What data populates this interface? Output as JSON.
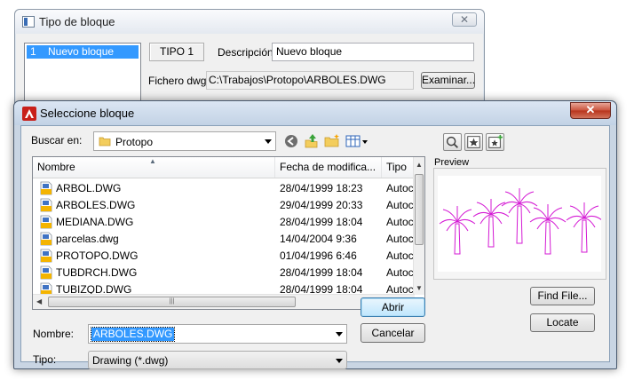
{
  "background_dialog": {
    "title": "Tipo de bloque",
    "close_label": "✕",
    "list_item_number": "1",
    "list_item_name": "Nuevo bloque",
    "tipo_label": "TIPO 1",
    "descripcion_label": "Descripción",
    "descripcion_value": "Nuevo bloque",
    "fichero_label": "Fichero dwg",
    "fichero_value": "C:\\Trabajos\\Protopo\\ARBOLES.DWG",
    "browse_label": "Examinar..."
  },
  "dialog": {
    "title": "Seleccione bloque",
    "close_label": "✕",
    "lookin_label": "Buscar en:",
    "lookin_value": "Protopo",
    "columns": [
      "Nombre",
      "Fecha de modifica...",
      "Tipo"
    ],
    "files": [
      {
        "name": "ARBOL.DWG",
        "date": "28/04/1999 18:23",
        "type": "Autoc"
      },
      {
        "name": "ARBOLES.DWG",
        "date": "29/04/1999 20:33",
        "type": "Autoc"
      },
      {
        "name": "MEDIANA.DWG",
        "date": "28/04/1999 18:04",
        "type": "Autoc"
      },
      {
        "name": "parcelas.dwg",
        "date": "14/04/2004 9:36",
        "type": "Autoc"
      },
      {
        "name": "PROTOPO.DWG",
        "date": "01/04/1996 6:46",
        "type": "Autoc"
      },
      {
        "name": "TUBDRCH.DWG",
        "date": "28/04/1999 18:04",
        "type": "Autoc"
      },
      {
        "name": "TUBIZQD.DWG",
        "date": "28/04/1999 18:04",
        "type": "Autoc"
      }
    ],
    "preview_label": "Preview",
    "find_file_label": "Find File...",
    "locate_label": "Locate",
    "nombre_label": "Nombre:",
    "nombre_value": "ARBOLES.DWG",
    "tipo_label": "Tipo:",
    "tipo_value": "Drawing (*.dwg)",
    "open_label": "Abrir",
    "cancel_label": "Cancelar",
    "preview_color": "#d41ad4",
    "selection_color": "#3399ff"
  }
}
